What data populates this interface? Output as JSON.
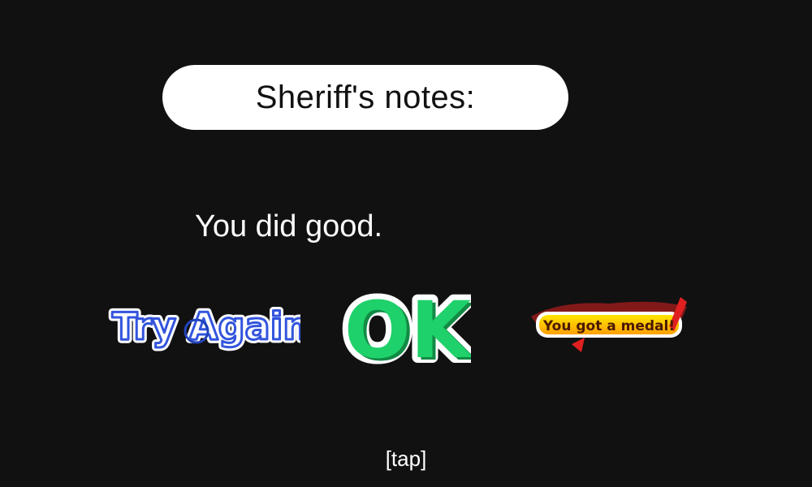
{
  "dialog": {
    "title": "Sheriff's notes:",
    "message": "You did good."
  },
  "ratings": {
    "try_again": {
      "label": "Try Again",
      "color": "#3355dd",
      "outline": "#ffffff"
    },
    "ok": {
      "label": "OK",
      "fill": "#1fd16a",
      "shadow": "#128a45",
      "outline": "#ffffff"
    },
    "medal": {
      "label": "You got a medal!",
      "band_top": "#ffe600",
      "band_bottom": "#ff9f00",
      "text_color": "#4a1a00",
      "accent": "#e02020"
    }
  },
  "hint": "[tap]"
}
